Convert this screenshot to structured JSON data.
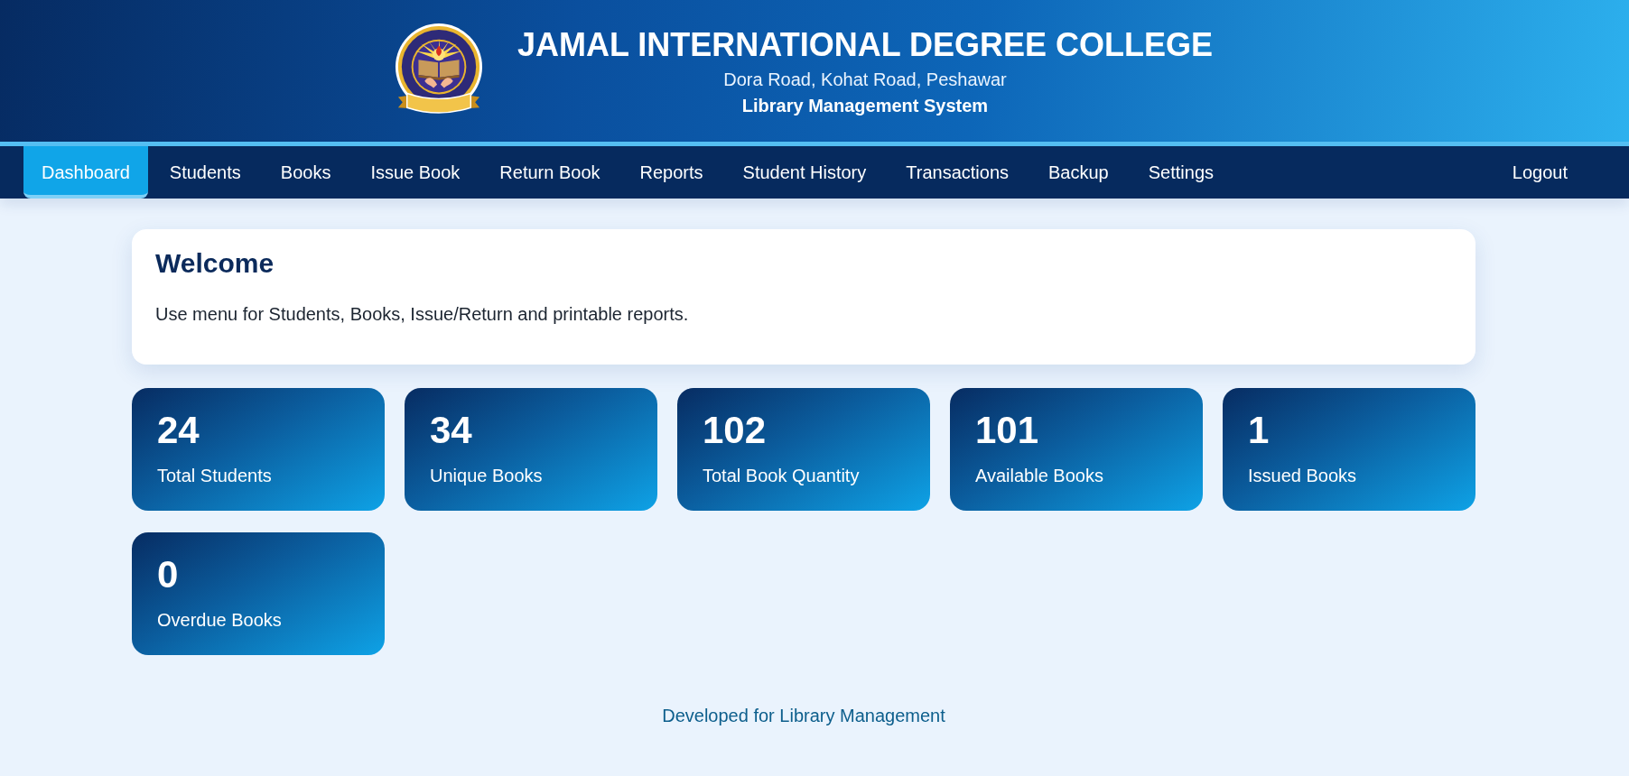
{
  "header": {
    "title": "JAMAL INTERNATIONAL DEGREE COLLEGE",
    "address": "Dora Road, Kohat Road, Peshawar",
    "system_name": "Library Management System"
  },
  "nav": {
    "items": [
      {
        "label": "Dashboard",
        "selected": true
      },
      {
        "label": "Students",
        "selected": false
      },
      {
        "label": "Books",
        "selected": false
      },
      {
        "label": "Issue Book",
        "selected": false
      },
      {
        "label": "Return Book",
        "selected": false
      },
      {
        "label": "Reports",
        "selected": false
      },
      {
        "label": "Student History",
        "selected": false
      },
      {
        "label": "Transactions",
        "selected": false
      },
      {
        "label": "Backup",
        "selected": false
      },
      {
        "label": "Settings",
        "selected": false
      }
    ],
    "logout": "Logout"
  },
  "welcome": {
    "heading": "Welcome",
    "text": "Use menu for Students, Books, Issue/Return and printable reports."
  },
  "stats": [
    {
      "value": "24",
      "label": "Total Students"
    },
    {
      "value": "34",
      "label": "Unique Books"
    },
    {
      "value": "102",
      "label": "Total Book Quantity"
    },
    {
      "value": "101",
      "label": "Available Books"
    },
    {
      "value": "1",
      "label": "Issued Books"
    },
    {
      "value": "0",
      "label": "Overdue Books"
    }
  ],
  "footer": "Developed for Library Management"
}
